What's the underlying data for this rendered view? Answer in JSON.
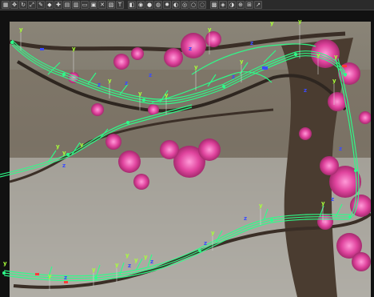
{
  "toolbar": {
    "buttons": [
      {
        "name": "select-tool-icon",
        "glyph": "▦"
      },
      {
        "name": "move-tool-icon",
        "glyph": "✥"
      },
      {
        "name": "rotate-tool-icon",
        "glyph": "↻"
      },
      {
        "name": "scale-tool-icon",
        "glyph": "⤢"
      },
      {
        "name": "brush-tool-icon",
        "glyph": "✎"
      },
      {
        "name": "node-tool-icon",
        "glyph": "◆"
      },
      {
        "name": "weld-tool-icon",
        "glyph": "✚"
      },
      {
        "name": "grid-icon",
        "glyph": "▤"
      },
      {
        "name": "layer-icon",
        "glyph": "▥"
      },
      {
        "name": "frame-icon",
        "glyph": "▭"
      },
      {
        "name": "render-icon",
        "glyph": "▣"
      },
      {
        "name": "close-view-icon",
        "glyph": "✕"
      },
      {
        "name": "wire-icon",
        "glyph": "▧"
      },
      {
        "name": "text-icon",
        "glyph": "T"
      },
      {
        "name": "camera-icon",
        "glyph": "◧"
      },
      {
        "name": "light-icon",
        "glyph": "◉"
      },
      {
        "name": "sphere-icon",
        "glyph": "●"
      },
      {
        "name": "material-icon",
        "glyph": "◍"
      },
      {
        "name": "sun-icon",
        "glyph": "✹"
      },
      {
        "name": "shade-icon",
        "glyph": "◐"
      },
      {
        "name": "globe-icon",
        "glyph": "◎"
      },
      {
        "name": "ball-icon",
        "glyph": "○"
      },
      {
        "name": "spot-icon",
        "glyph": "◌"
      },
      {
        "name": "lock-icon",
        "glyph": "▩"
      },
      {
        "name": "pan-icon",
        "glyph": "◈"
      },
      {
        "name": "orbit-icon",
        "glyph": "◑"
      },
      {
        "name": "zoom-icon",
        "glyph": "⊕"
      },
      {
        "name": "snap-icon",
        "glyph": "⊞"
      },
      {
        "name": "expand-icon",
        "glyph": "↗"
      }
    ]
  },
  "viewport": {
    "axis_y_label": "y",
    "axis_z_label": "z",
    "colors": {
      "spline": "#2dff8a",
      "y_axis": "#a8ff3a",
      "z_axis": "#3a4bff",
      "x_axis": "#ff3a3a"
    }
  }
}
